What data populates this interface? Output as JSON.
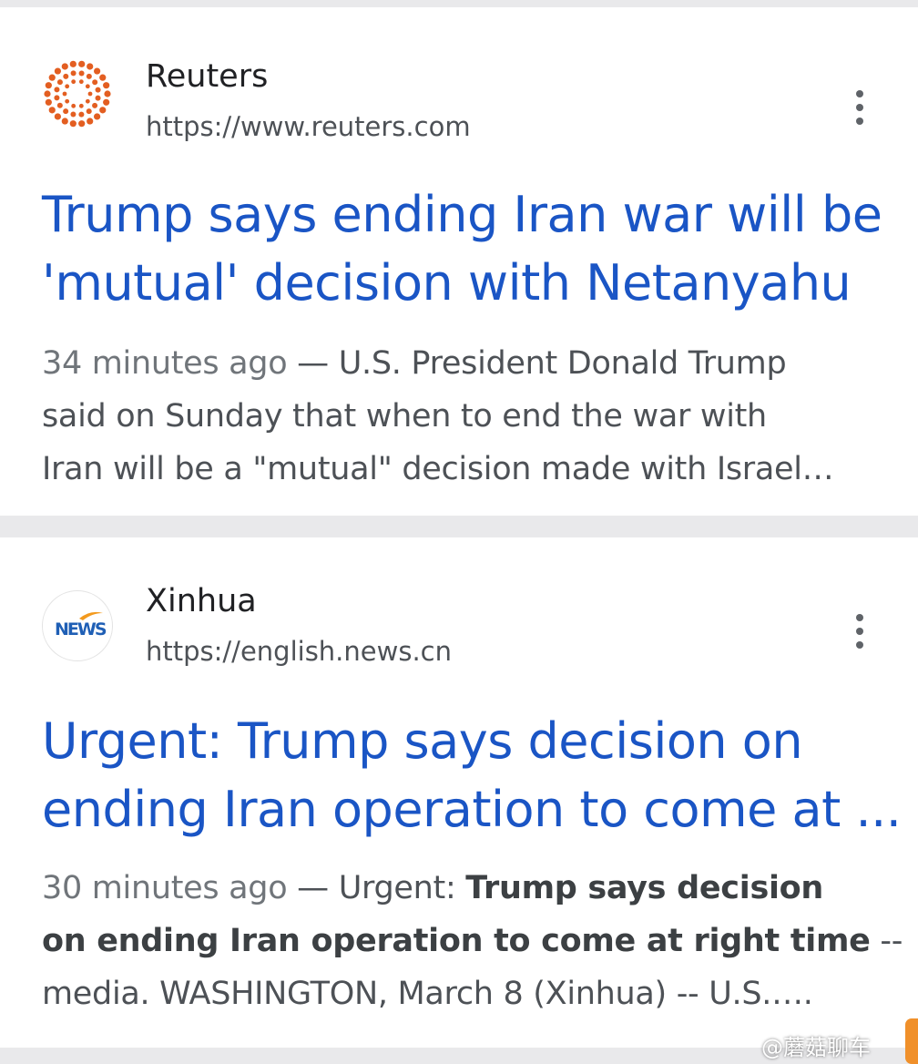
{
  "results": [
    {
      "site_name": "Reuters",
      "url": "https://www.reuters.com",
      "favicon": "reuters-dot-ring-logo",
      "headline_lines": [
        "Trump says ending Iran war will be",
        "'mutual' decision with Netanyahu"
      ],
      "snippet": {
        "time": "34 minutes ago",
        "separator": "—",
        "lines": [
          "U.S. President Donald Trump",
          "said on Sunday that when to end the war with",
          "Iran will be a \"mutual\" decision made with Israel…"
        ]
      }
    },
    {
      "site_name": "Xinhua",
      "url": "https://english.news.cn",
      "favicon": "xinhua-news-logo",
      "favicon_text": "NEWS",
      "headline_lines": [
        "Urgent: Trump says decision on",
        "ending Iran operation to come at ..."
      ],
      "snippet": {
        "time": "30 minutes ago",
        "separator": "—",
        "prefix": "Urgent:",
        "bold_1": "Trump says decision",
        "bold_2": "on ending Iran operation to come at right time",
        "tail_1": "--",
        "line_3": "media. WASHINGTON, March 8 (Xinhua) -- U.S.…."
      }
    }
  ],
  "watermark": "@蘑菇聊车",
  "colors": {
    "headline": "#1a55c5",
    "snippet": "#4d5156",
    "background": "#e9e9eb",
    "reuters_orange": "#e35e21"
  }
}
